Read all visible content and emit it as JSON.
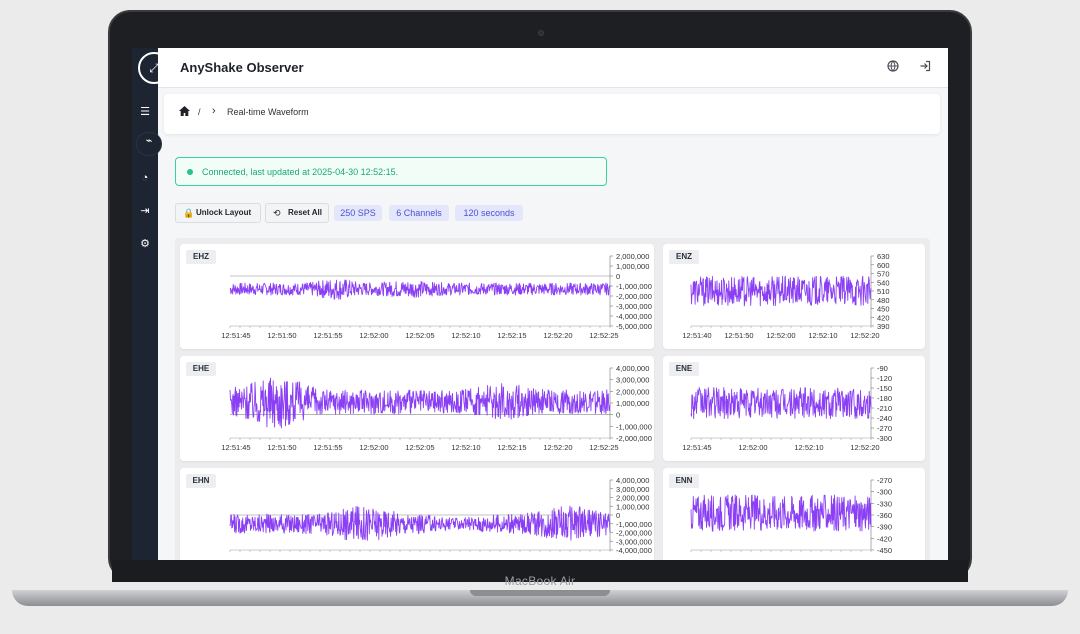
{
  "device": {
    "brand": "MacBook Air"
  },
  "app": {
    "title": "AnyShake Observer"
  },
  "sidebar": {
    "logo_icon": "expand-icon",
    "items": [
      {
        "name": "sidebar-item-stations",
        "icon": "server-icon",
        "glyph": "☰"
      },
      {
        "name": "sidebar-item-waveform",
        "icon": "waveform-icon",
        "glyph": "⌁",
        "active": true
      },
      {
        "name": "sidebar-item-history",
        "icon": "history-icon",
        "glyph": "◔"
      },
      {
        "name": "sidebar-item-export",
        "icon": "export-icon",
        "glyph": "⇥"
      },
      {
        "name": "sidebar-item-settings",
        "icon": "gear-icon",
        "glyph": "⚙"
      }
    ]
  },
  "topbar": {
    "language_icon": "globe-icon",
    "logout_icon": "logout-icon"
  },
  "breadcrumb": {
    "home_icon": "home-icon",
    "separator": "/",
    "chevron": "›",
    "current": "Real-time Waveform"
  },
  "status": {
    "text": "Connected, last updated at 2025-04-30 12:52:15.",
    "color": "#1aa877"
  },
  "toolbar": {
    "unlock_label": "Unlock Layout",
    "reset_label": "Reset All",
    "chips": [
      "250 SPS",
      "6 Channels",
      "120 seconds"
    ]
  },
  "colors": {
    "trace": "#8a3ff5",
    "accent": "#4a51d6"
  },
  "chart_data": [
    {
      "type": "line",
      "title": "EHZ",
      "x_ticks": [
        "12:51:45",
        "12:51:50",
        "12:51:55",
        "12:52:00",
        "12:52:05",
        "12:52:10",
        "12:52:15",
        "12:52:20",
        "12:52:25"
      ],
      "y_ticks": [
        "2,000,000",
        "1,000,000",
        "0",
        "-1,000,000",
        "-2,000,000",
        "-3,000,000",
        "-4,000,000",
        "-5,000,000"
      ],
      "ylim": [
        -5000000,
        2000000
      ],
      "center": -1300000,
      "amplitude": 1100000,
      "env": "burst-early"
    },
    {
      "type": "line",
      "title": "ENZ",
      "x_ticks": [
        "12:51:40",
        "12:51:50",
        "12:52:00",
        "12:52:10",
        "12:52:20"
      ],
      "y_ticks": [
        "630",
        "600",
        "570",
        "540",
        "510",
        "480",
        "450",
        "420",
        "390"
      ],
      "ylim": [
        390,
        630
      ],
      "center": 510,
      "amplitude": 60,
      "env": "flat"
    },
    {
      "type": "line",
      "title": "EHE",
      "x_ticks": [
        "12:51:45",
        "12:51:50",
        "12:51:55",
        "12:52:00",
        "12:52:05",
        "12:52:10",
        "12:52:15",
        "12:52:20",
        "12:52:25"
      ],
      "y_ticks": [
        "4,000,000",
        "3,000,000",
        "2,000,000",
        "1,000,000",
        "0",
        "-1,000,000",
        "-2,000,000"
      ],
      "ylim": [
        -2000000,
        4000000
      ],
      "center": 1100000,
      "amplitude": 2300000,
      "env": "burst-early-strong"
    },
    {
      "type": "line",
      "title": "ENE",
      "x_ticks": [
        "12:51:45",
        "12:52:00",
        "12:52:10",
        "12:52:20"
      ],
      "y_ticks": [
        "-90",
        "-120",
        "-150",
        "-180",
        "-210",
        "-240",
        "-270",
        "-300"
      ],
      "ylim": [
        -300,
        -90
      ],
      "center": -195,
      "amplitude": 55,
      "env": "flat"
    },
    {
      "type": "line",
      "title": "EHN",
      "x_ticks": [],
      "y_ticks": [
        "4,000,000",
        "3,000,000",
        "2,000,000",
        "1,000,000",
        "0",
        "-1,000,000",
        "-2,000,000",
        "-3,000,000",
        "-4,000,000"
      ],
      "ylim": [
        -4000000,
        4000000
      ],
      "center": -1000000,
      "amplitude": 2200000,
      "env": "two-bursts"
    },
    {
      "type": "line",
      "title": "ENN",
      "x_ticks": [],
      "y_ticks": [
        "-270",
        "-300",
        "-330",
        "-360",
        "-390",
        "-420",
        "-450"
      ],
      "ylim": [
        -450,
        -270
      ],
      "center": -355,
      "amplitude": 55,
      "env": "flat"
    }
  ]
}
